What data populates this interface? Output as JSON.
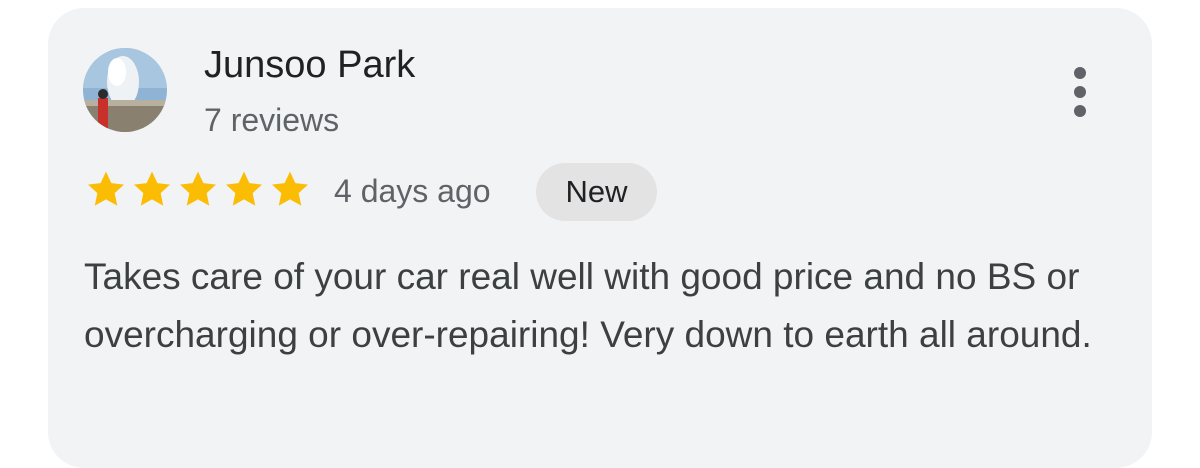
{
  "review": {
    "reviewer_name": "Junsoo Park",
    "reviewer_meta": "7 reviews",
    "rating": 5,
    "rating_max": 5,
    "time_ago": "4 days ago",
    "badge": "New",
    "text": "Takes care of your car real well with good price and no BS or overcharging or over-repairing! Very down to earth all around."
  },
  "icons": {
    "more": "more-vert-icon",
    "star": "star-icon"
  },
  "colors": {
    "card_background": "#f1f3f4",
    "star": "#fbbc04",
    "badge_background": "#e3e3e3",
    "primary_text": "#202124",
    "secondary_text": "#5f6368"
  }
}
